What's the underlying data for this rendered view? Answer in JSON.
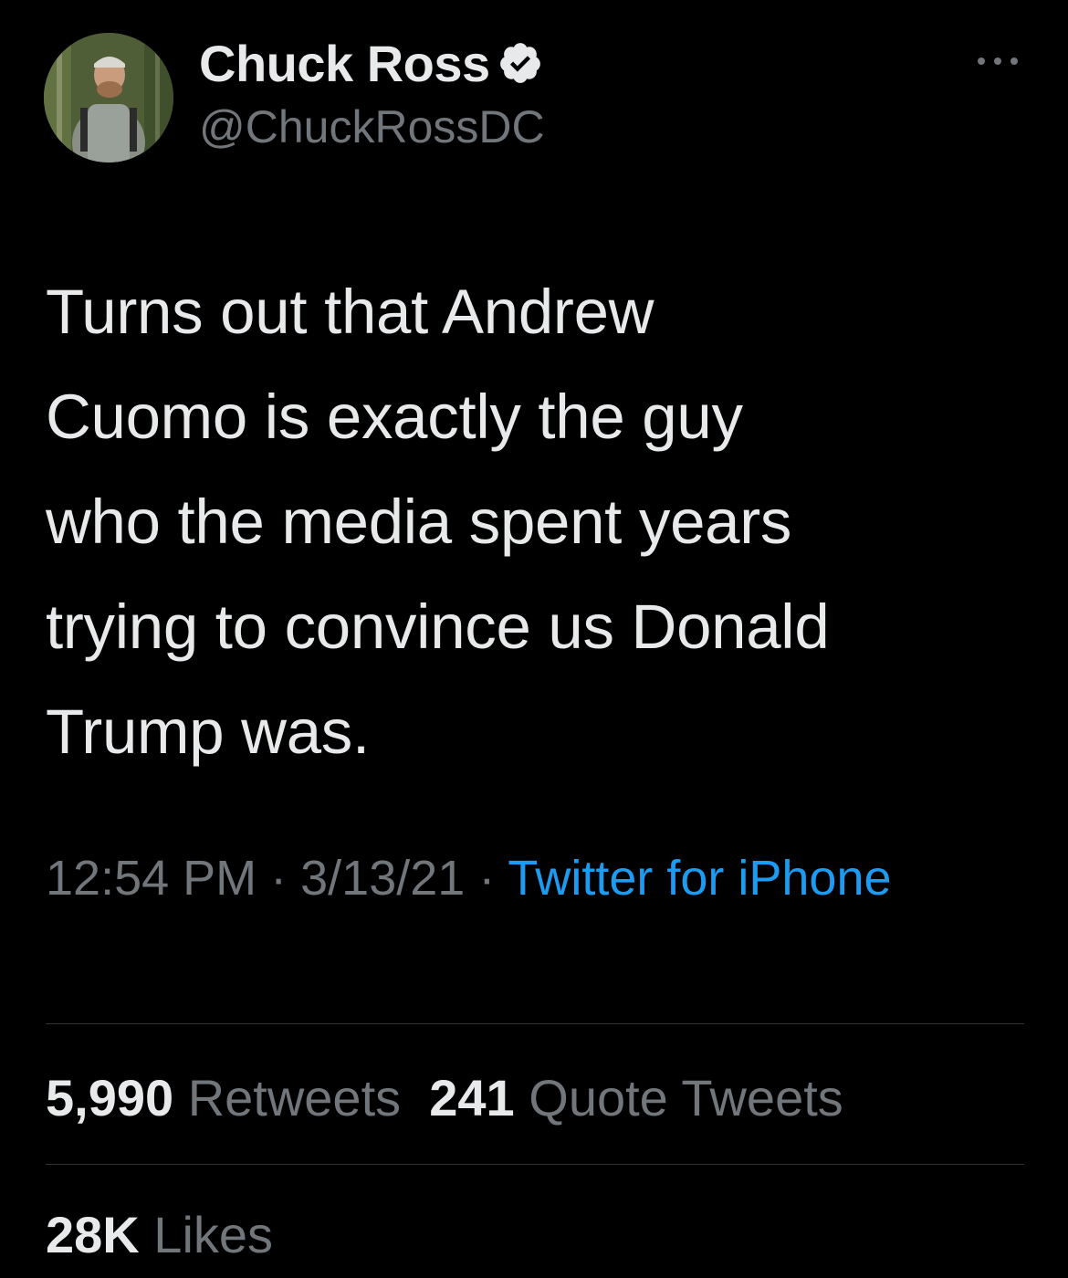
{
  "author": {
    "display_name": "Chuck Ross",
    "handle": "@ChuckRossDC",
    "verified": true,
    "verified_color": "#e7e9ea"
  },
  "tweet": {
    "text": "Turns out that Andrew\nCuomo is exactly the guy\nwho the media spent years\ntrying to convince us Donald\nTrump was.",
    "time": "12:54 PM",
    "separator": " · ",
    "date": "3/13/21",
    "source": "Twitter for iPhone"
  },
  "stats": {
    "retweets_count": "5,990",
    "retweets_label": "Retweets",
    "quotes_count": "241",
    "quotes_label": "Quote Tweets",
    "likes_count": "28K",
    "likes_label": "Likes"
  },
  "icons": {
    "more": "more-options-icon",
    "verified": "verified-badge-icon"
  },
  "colors": {
    "background": "#000000",
    "text": "#e7e9ea",
    "secondary": "#71767b",
    "link": "#1d9bf0",
    "divider": "#2f3336"
  }
}
